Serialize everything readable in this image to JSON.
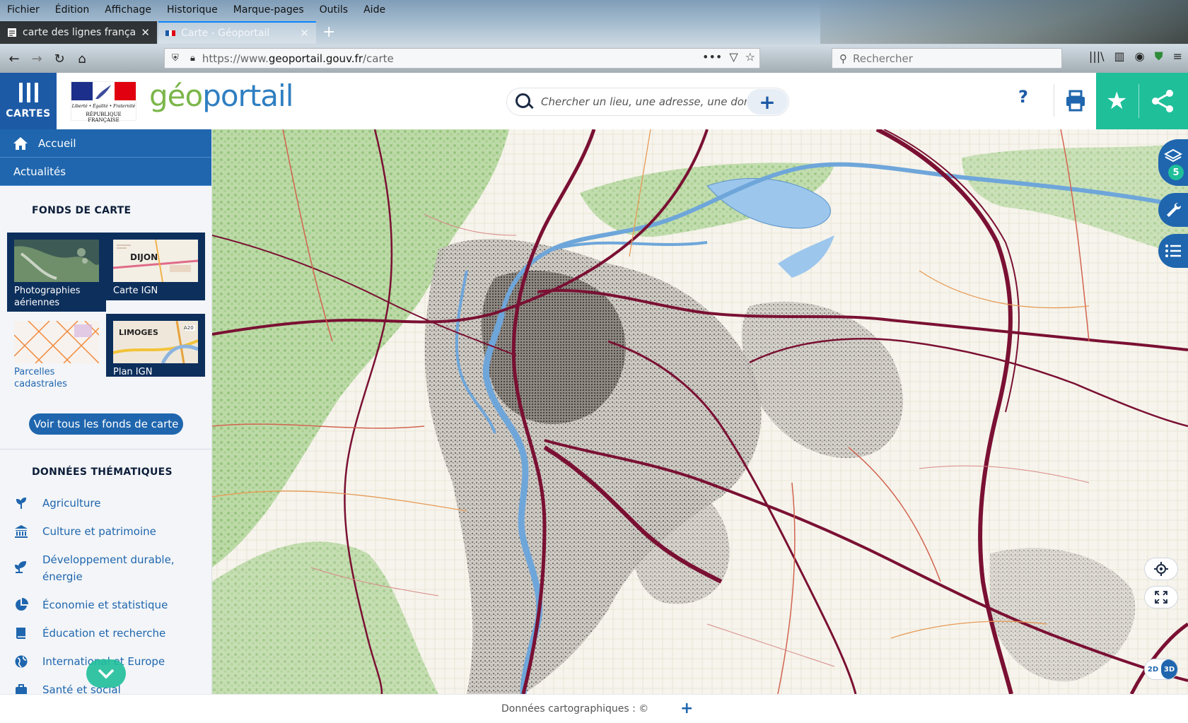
{
  "browser": {
    "menu": [
      "Fichier",
      "Édition",
      "Affichage",
      "Historique",
      "Marque-pages",
      "Outils",
      "Aide"
    ],
    "tabs": [
      {
        "title": "carte des lignes françaises"
      },
      {
        "title": "Carte - Géoportail"
      }
    ],
    "url_prefix": "https://www.",
    "url_domain": "geoportail.gouv.fr",
    "url_path": "/carte",
    "search_placeholder": "Rechercher"
  },
  "header": {
    "cartes_label": "CARTES",
    "rf_motto": "Liberté • Égalité • Fraternité",
    "rf_name": "RÉPUBLIQUE FRANÇAISE",
    "logo_geo": "géo",
    "logo_portail": "portail",
    "search_placeholder": "Chercher un lieu, une adresse, une donnée",
    "help_label": "?"
  },
  "sidebar": {
    "nav": [
      {
        "label": "Accueil"
      },
      {
        "label": "Actualités"
      }
    ],
    "fonds_title": "FONDS DE CARTE",
    "fonds": [
      {
        "label": "Photographies aériennes",
        "selected": true
      },
      {
        "label": "Carte IGN",
        "selected": true,
        "thumb_text": "DIJON"
      },
      {
        "label": "Parcelles cadastrales",
        "selected": false
      },
      {
        "label": "Plan IGN",
        "selected": true,
        "thumb_text": "LIMOGES",
        "thumb_road": "A20"
      }
    ],
    "voir_button": "Voir tous les fonds de carte",
    "themes_title": "DONNÉES THÉMATIQUES",
    "themes": [
      {
        "label": "Agriculture",
        "icon": "leaf-icon"
      },
      {
        "label": "Culture et patrimoine",
        "icon": "monument-icon"
      },
      {
        "label": "Développement durable, énergie",
        "icon": "sprout-icon"
      },
      {
        "label": "Économie et statistique",
        "icon": "pie-chart-icon"
      },
      {
        "label": "Éducation et recherche",
        "icon": "book-icon"
      },
      {
        "label": "International et Europe",
        "icon": "globe-icon"
      },
      {
        "label": "Santé et social",
        "icon": "briefcase-icon"
      }
    ]
  },
  "map": {
    "layers_count": "5",
    "btn_2d": "2D",
    "btn_3d": "3D"
  },
  "footer": {
    "credits": "Données cartographiques : ©"
  },
  "colors": {
    "primary_blue": "#1f66ae",
    "teal": "#1fbf9a",
    "navy": "#0d2f5c",
    "road": "#7a1033"
  }
}
